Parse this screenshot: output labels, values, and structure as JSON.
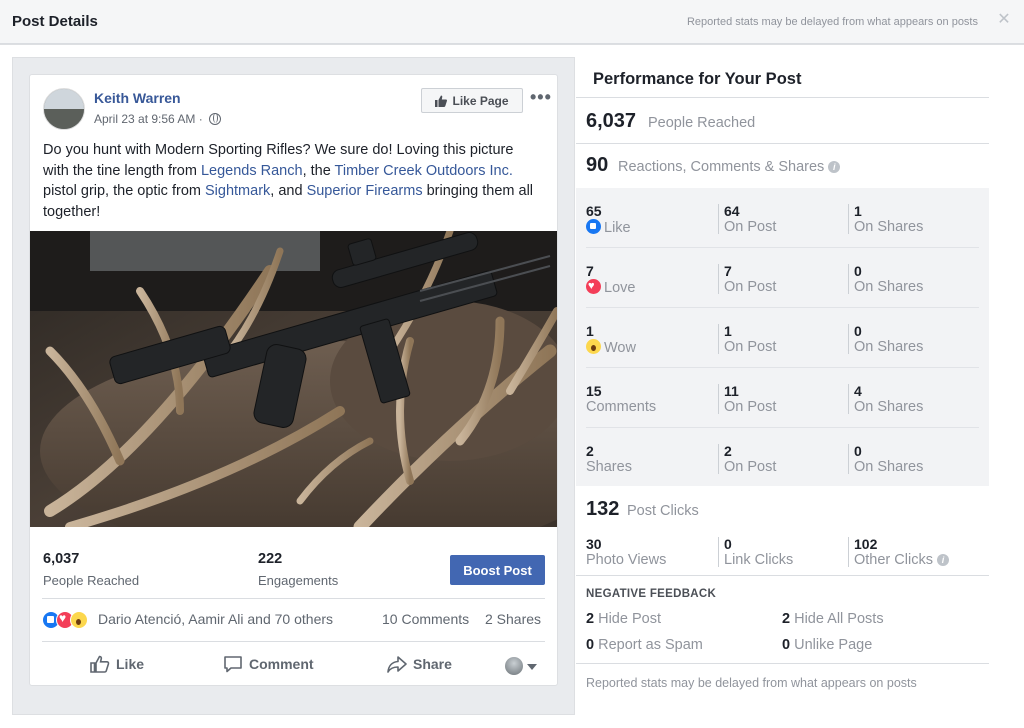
{
  "header": {
    "title": "Post Details",
    "note": "Reported stats may be delayed from what appears on posts",
    "close_icon": "close-icon"
  },
  "post": {
    "author": "Keith Warren",
    "date": "April 23 at 9:56 AM ·",
    "like_page_label": "Like Page",
    "more_label": "•••",
    "text": {
      "p1": "Do you hunt with Modern Sporting Rifles? We sure do! Loving this picture with the tine length from ",
      "link1": "Legends Ranch",
      "p2": ", the ",
      "link2": "Timber Creek Outdoors Inc.",
      "p3": " pistol grip, the optic from ",
      "link3": "Sightmark",
      "p4": ", and ",
      "link4": "Superior Firearms",
      "p5": " bringing them all together!"
    },
    "stats": {
      "reached_value": "6,037",
      "reached_label": "People Reached",
      "engagements_value": "222",
      "engagements_label": "Engagements",
      "boost_label": "Boost Post"
    },
    "reactions": {
      "names": "Dario Atenció, Aamir Ali and 70 others",
      "comments": "10 Comments",
      "shares": "2 Shares"
    },
    "actions": {
      "like": "Like",
      "comment": "Comment",
      "share": "Share"
    }
  },
  "performance": {
    "title": "Performance for Your Post",
    "reached_value": "6,037",
    "reached_label": "People Reached",
    "rcs_value": "90",
    "rcs_label": "Reactions, Comments & Shares",
    "rows": [
      {
        "n1": "65",
        "l1": "Like",
        "n2": "64",
        "l2": "On Post",
        "n3": "1",
        "l3": "On Shares"
      },
      {
        "n1": "7",
        "l1": "Love",
        "n2": "7",
        "l2": "On Post",
        "n3": "0",
        "l3": "On Shares"
      },
      {
        "n1": "1",
        "l1": "Wow",
        "n2": "1",
        "l2": "On Post",
        "n3": "0",
        "l3": "On Shares"
      },
      {
        "n1": "15",
        "l1": "Comments",
        "n2": "11",
        "l2": "On Post",
        "n3": "4",
        "l3": "On Shares"
      },
      {
        "n1": "2",
        "l1": "Shares",
        "n2": "2",
        "l2": "On Post",
        "n3": "0",
        "l3": "On Shares"
      }
    ],
    "clicks_value": "132",
    "clicks_label": "Post Clicks",
    "clicks": {
      "photo_value": "30",
      "photo_label": "Photo Views",
      "link_value": "0",
      "link_label": "Link Clicks",
      "other_value": "102",
      "other_label": "Other Clicks"
    },
    "negative": {
      "title": "NEGATIVE FEEDBACK",
      "hide_post_value": "2",
      "hide_post_label": "Hide Post",
      "hide_all_value": "2",
      "hide_all_label": "Hide All Posts",
      "spam_value": "0",
      "spam_label": "Report as Spam",
      "unlike_value": "0",
      "unlike_label": "Unlike Page"
    },
    "footer_note": "Reported stats may be delayed from what appears on posts"
  },
  "colors": {
    "link": "#365899",
    "boost": "#4267b2",
    "muted": "#90949c"
  }
}
